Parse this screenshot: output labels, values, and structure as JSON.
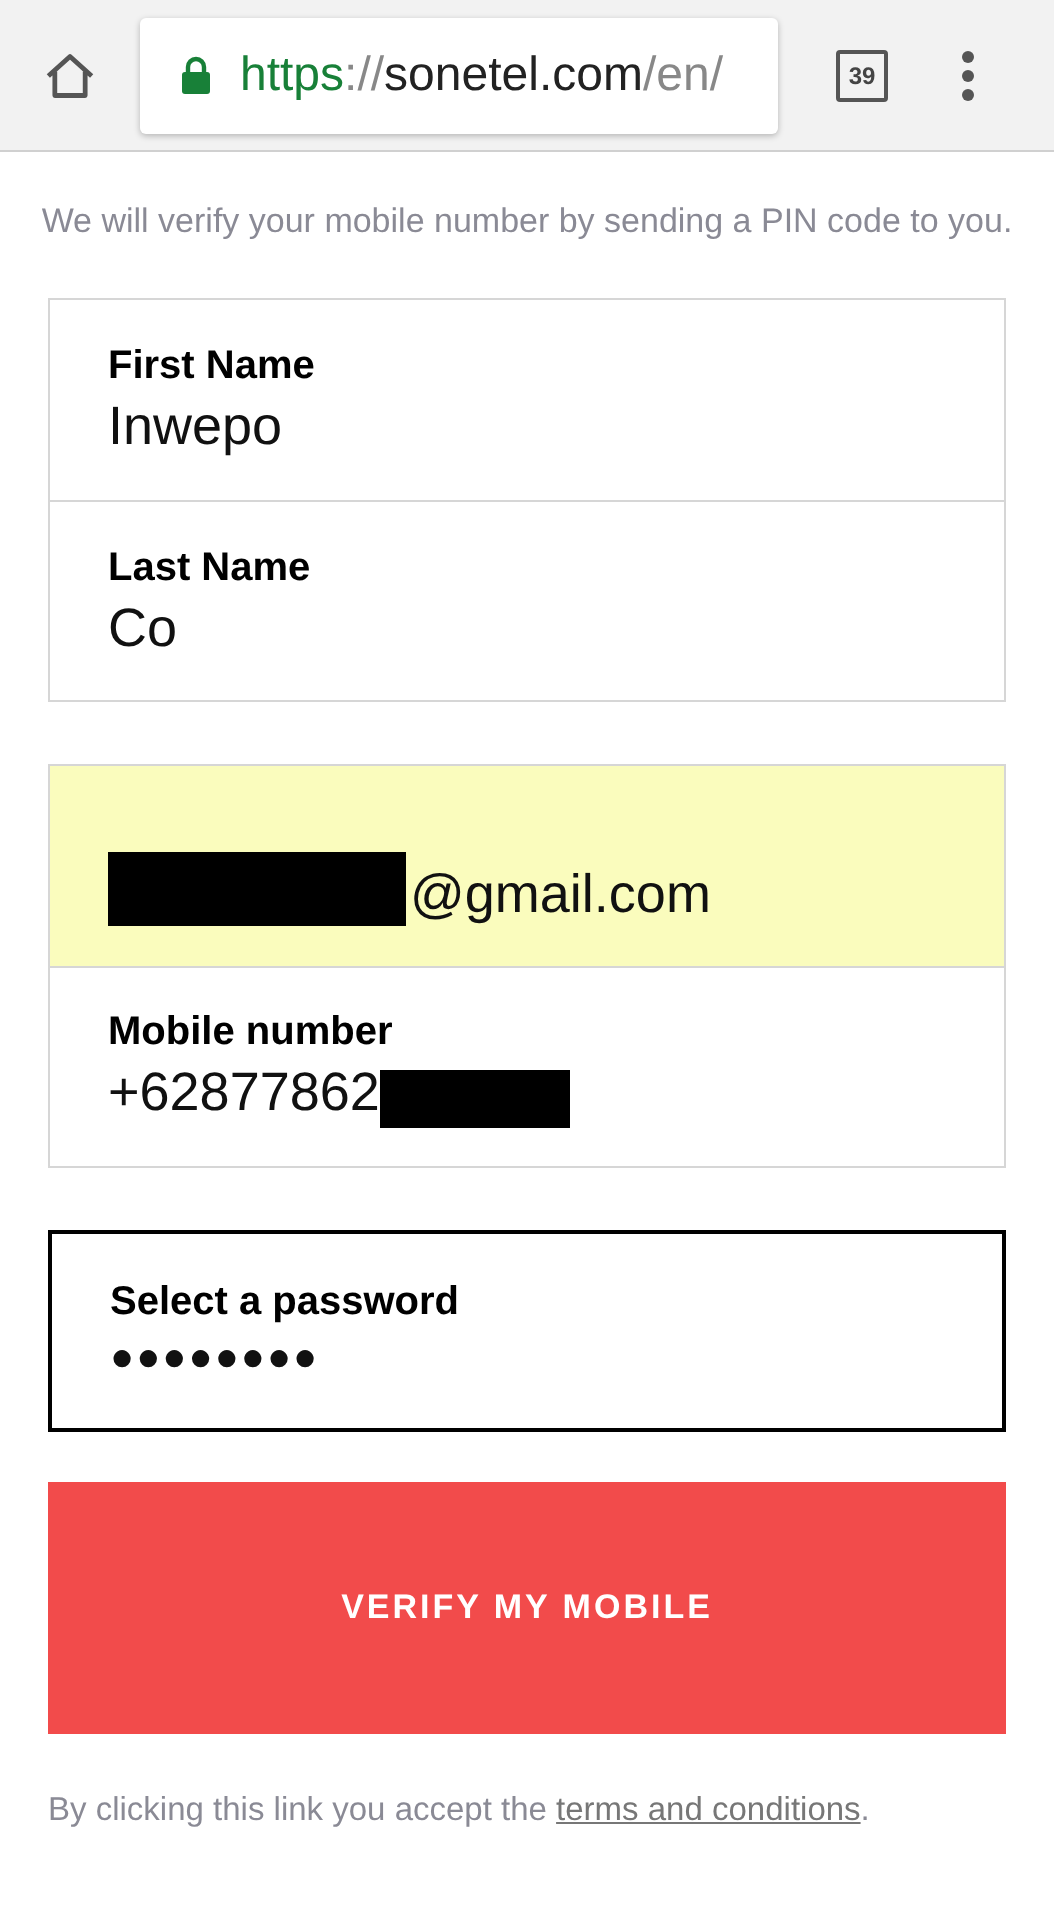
{
  "browser": {
    "url": {
      "scheme": "https",
      "separator": "://",
      "host": "sonetel.com",
      "path": "/en/"
    },
    "tab_count": "39"
  },
  "intro": "We will verify your mobile number by sending a PIN code to you.",
  "groups": [
    {
      "fields": [
        {
          "kind": "text",
          "label": "First Name",
          "value": "Inwepo",
          "autofilled": false,
          "focused": false,
          "redacted": false
        },
        {
          "kind": "text",
          "label": "Last Name",
          "value": "Co",
          "autofilled": false,
          "focused": false,
          "redacted": false
        }
      ]
    },
    {
      "fields": [
        {
          "kind": "email",
          "value": "@gmail.com",
          "autofilled": true,
          "focused": false,
          "redacted": true
        },
        {
          "kind": "text",
          "label": "Mobile number",
          "value": "+62877862",
          "autofilled": false,
          "focused": false,
          "redacted": true
        }
      ]
    },
    {
      "fields": [
        {
          "kind": "password",
          "label": "Select a password",
          "value": "●●●●●●●●",
          "autofilled": false,
          "focused": true,
          "redacted": false
        }
      ]
    }
  ],
  "submit": "VERIFY MY MOBILE",
  "footer": {
    "text": "By clicking this link you accept the ",
    "link": "terms and conditions",
    "end": "."
  }
}
